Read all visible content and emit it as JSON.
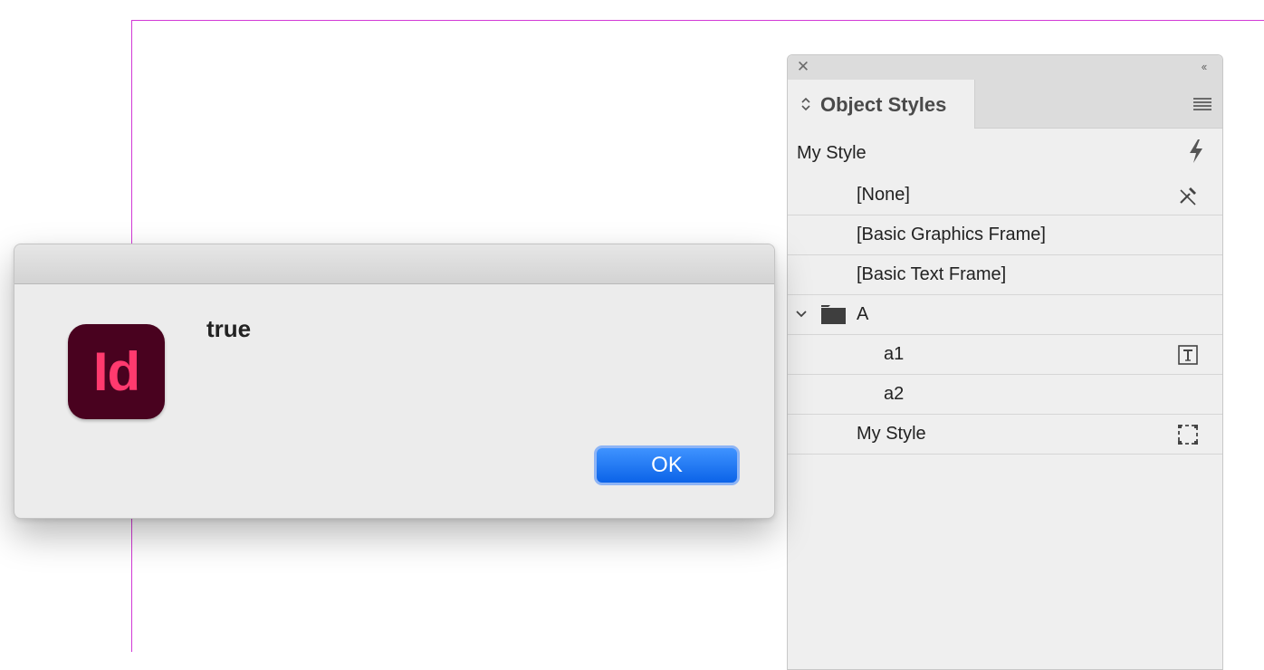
{
  "panel": {
    "title": "Object Styles",
    "current_style": "My Style",
    "colors": {
      "panel_bg": "#efefef",
      "titlebar_bg": "#dcdcdc"
    },
    "styles": [
      {
        "label": "[None]",
        "indent": 1,
        "icon": "no-style-icon"
      },
      {
        "label": "[Basic Graphics Frame]",
        "indent": 1,
        "icon": null
      },
      {
        "label": "[Basic Text Frame]",
        "indent": 1,
        "icon": null
      },
      {
        "label": "A",
        "indent": 0,
        "type": "group",
        "expanded": true,
        "icon": "folder-icon"
      },
      {
        "label": "a1",
        "indent": 2,
        "icon": "text-frame-icon"
      },
      {
        "label": "a2",
        "indent": 2,
        "icon": null
      },
      {
        "label": "My Style",
        "indent": 1,
        "icon": "graphic-frame-icon"
      }
    ]
  },
  "dialog": {
    "app_icon_text": "Id",
    "message": "true",
    "ok_label": "OK",
    "colors": {
      "app_icon_bg": "#49021f",
      "app_icon_fg": "#ff3a6e",
      "button_accent": "#0b63e8"
    }
  },
  "guides": {
    "margin_color": "#d23ad6"
  }
}
